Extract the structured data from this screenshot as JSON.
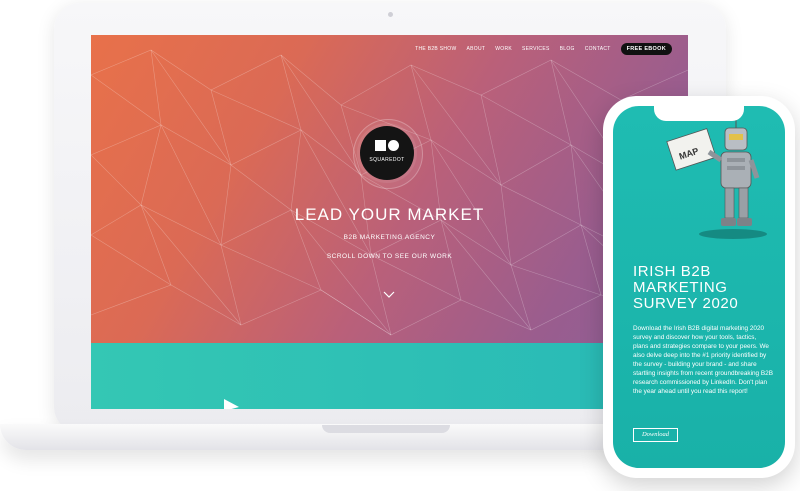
{
  "laptop": {
    "nav": {
      "items": [
        "THE B2B SHOW",
        "ABOUT",
        "WORK",
        "SERVICES",
        "BLOG",
        "CONTACT"
      ],
      "cta": "FREE EBOOK"
    },
    "logo_text": "SQUAREDOT",
    "headline": "LEAD YOUR MARKET",
    "subheading": "B2B MARKETING AGENCY",
    "scroll_hint": "SCROLL DOWN TO SEE OUR WORK",
    "scroll_icon": "chevron-down-icon"
  },
  "phone": {
    "sign_text": "MAP",
    "title_lines": [
      "IRISH B2B",
      "MARKETING",
      "SURVEY 2020"
    ],
    "body": "Download the Irish B2B digital marketing 2020 survey and discover how your tools, tactics, plans and strategies compare to your peers. We also delve deep into the #1 priority identified by the survey - building your brand - and share startling insights from recent groundbreaking B2B research commissioned by LinkedIn. Don't plan the year ahead until you read this report!",
    "button": "Download"
  },
  "colors": {
    "hero_orange": "#e8714a",
    "hero_purple": "#8c5f98",
    "teal": "#2fc4b2",
    "phone_teal": "#1fbcb2"
  }
}
